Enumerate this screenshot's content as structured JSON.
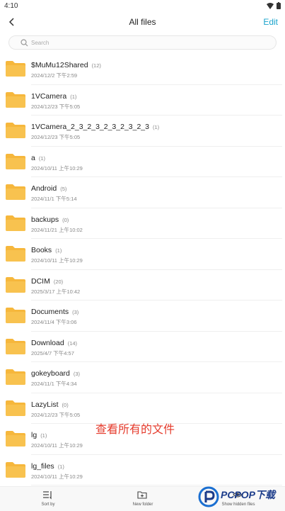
{
  "status": {
    "time": "4:10"
  },
  "header": {
    "title": "All files",
    "edit_label": "Edit"
  },
  "search": {
    "placeholder": "Search"
  },
  "files": [
    {
      "name": "$MuMu12Shared",
      "count": "(12)",
      "date": "2024/12/2 下午2:59"
    },
    {
      "name": "1VCamera",
      "count": "(1)",
      "date": "2024/12/23 下午5:05"
    },
    {
      "name": "1VCamera_2_3_2_3_2_3_2_3_2_3",
      "count": "(1)",
      "date": "2024/12/23 下午5:05"
    },
    {
      "name": "a",
      "count": "(1)",
      "date": "2024/10/11 上午10:29"
    },
    {
      "name": "Android",
      "count": "(5)",
      "date": "2024/11/1 下午5:14"
    },
    {
      "name": "backups",
      "count": "(0)",
      "date": "2024/11/21 上午10:02"
    },
    {
      "name": "Books",
      "count": "(1)",
      "date": "2024/10/11 上午10:29"
    },
    {
      "name": "DCIM",
      "count": "(20)",
      "date": "2025/3/17 上午10:42"
    },
    {
      "name": "Documents",
      "count": "(3)",
      "date": "2024/11/4 下午3:06"
    },
    {
      "name": "Download",
      "count": "(14)",
      "date": "2025/4/7 下午4:57"
    },
    {
      "name": "gokeyboard",
      "count": "(3)",
      "date": "2024/11/1 下午4:34"
    },
    {
      "name": "LazyList",
      "count": "(0)",
      "date": "2024/12/23 下午5:05"
    },
    {
      "name": "lg",
      "count": "(1)",
      "date": "2024/10/11 上午10:29"
    },
    {
      "name": "lg_files",
      "count": "(1)",
      "date": "2024/10/11 上午10:29"
    }
  ],
  "overlay": {
    "caption": "查看所有的文件"
  },
  "toolbar": {
    "sort_label": "Sort by",
    "new_folder_label": "New folder",
    "hidden_label": "Show hidden files"
  },
  "watermark": {
    "text": "PCPOP下载"
  },
  "colors": {
    "accent": "#1aa3cc",
    "folder": "#f6b73c",
    "caption": "#e53b2c"
  }
}
